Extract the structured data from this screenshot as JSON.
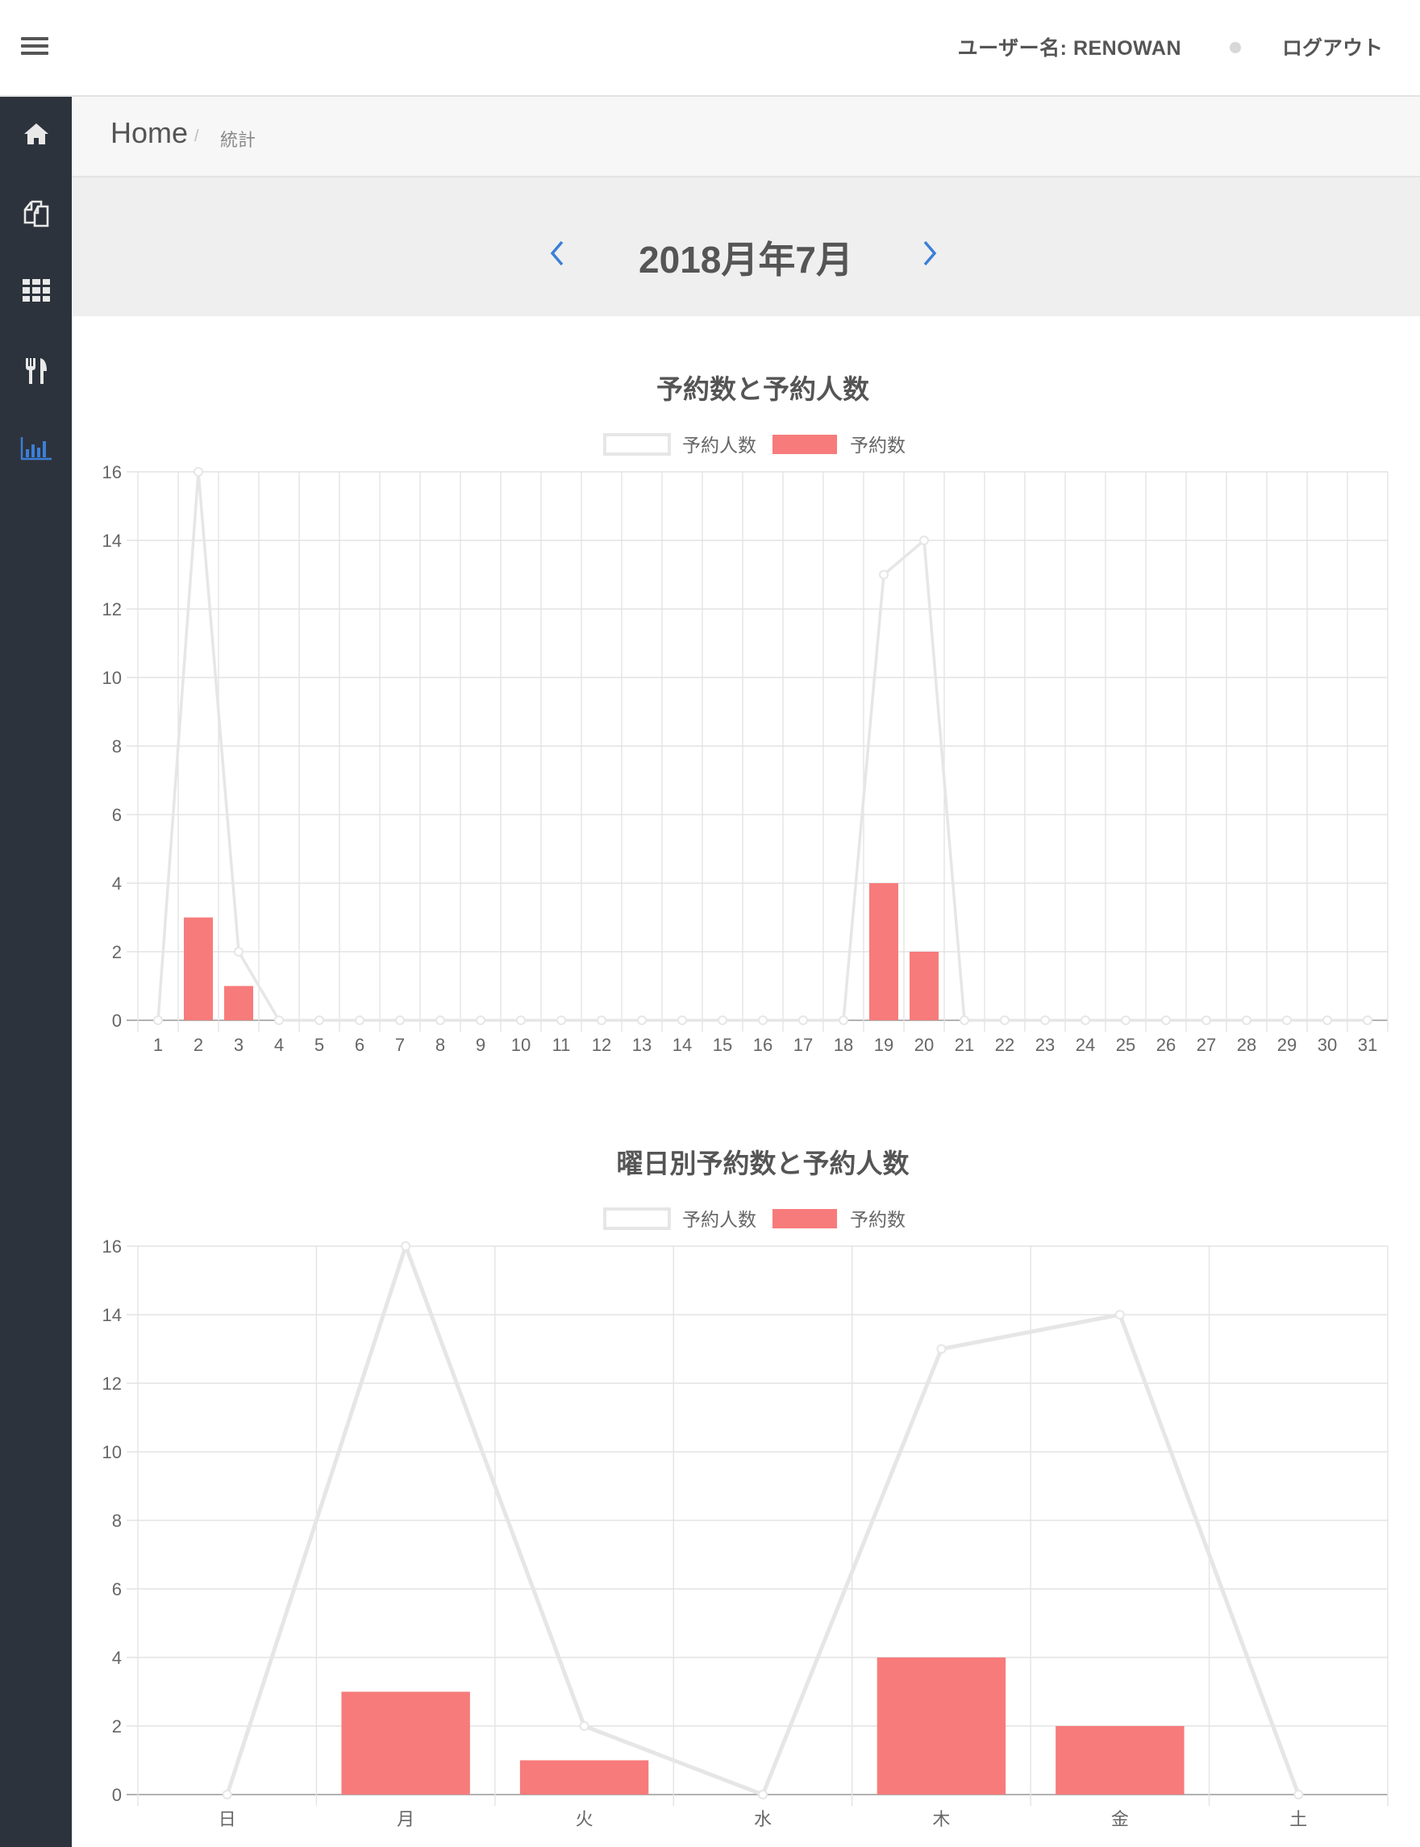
{
  "header": {
    "user_label": "ユーザー名: RENOWAN",
    "logout_label": "ログアウト"
  },
  "sidebar": {
    "items": [
      {
        "icon": "home-icon",
        "active": false
      },
      {
        "icon": "documents-icon",
        "active": false
      },
      {
        "icon": "grid-icon",
        "active": false
      },
      {
        "icon": "restaurant-icon",
        "active": false
      },
      {
        "icon": "bar-chart-icon",
        "active": true
      }
    ]
  },
  "breadcrumb": {
    "home": "Home",
    "separator": "/",
    "current": "統計"
  },
  "month_nav": {
    "title": "2018月年7月"
  },
  "colors": {
    "sidebar_bg": "#2d333c",
    "accent": "#3b7fd8",
    "bar": "#f77b7b",
    "line": "#e6e6e6"
  },
  "chart_data": [
    {
      "type": "bar",
      "title": "予約数と予約人数",
      "legend_position": "top",
      "grid": true,
      "categories": [
        "1",
        "2",
        "3",
        "4",
        "5",
        "6",
        "7",
        "8",
        "9",
        "10",
        "11",
        "12",
        "13",
        "14",
        "15",
        "16",
        "17",
        "18",
        "19",
        "20",
        "21",
        "22",
        "23",
        "24",
        "25",
        "26",
        "27",
        "28",
        "29",
        "30",
        "31"
      ],
      "ylim": [
        0,
        16
      ],
      "yticks": [
        0,
        2,
        4,
        6,
        8,
        10,
        12,
        14,
        16
      ],
      "series": [
        {
          "name": "予約人数",
          "kind": "line",
          "values": [
            0,
            16,
            2,
            0,
            0,
            0,
            0,
            0,
            0,
            0,
            0,
            0,
            0,
            0,
            0,
            0,
            0,
            0,
            13,
            14,
            0,
            0,
            0,
            0,
            0,
            0,
            0,
            0,
            0,
            0,
            0
          ]
        },
        {
          "name": "予約数",
          "kind": "bar",
          "values": [
            0,
            3,
            1,
            0,
            0,
            0,
            0,
            0,
            0,
            0,
            0,
            0,
            0,
            0,
            0,
            0,
            0,
            0,
            4,
            2,
            0,
            0,
            0,
            0,
            0,
            0,
            0,
            0,
            0,
            0,
            0
          ]
        }
      ]
    },
    {
      "type": "bar",
      "title": "曜日別予約数と予約人数",
      "legend_position": "top",
      "grid": true,
      "categories": [
        "日",
        "月",
        "火",
        "水",
        "木",
        "金",
        "土"
      ],
      "ylim": [
        0,
        16
      ],
      "yticks": [
        0,
        2,
        4,
        6,
        8,
        10,
        12,
        14,
        16
      ],
      "series": [
        {
          "name": "予約人数",
          "kind": "line",
          "values": [
            0,
            16,
            2,
            0,
            13,
            14,
            0
          ]
        },
        {
          "name": "予約数",
          "kind": "bar",
          "values": [
            0,
            3,
            1,
            0,
            4,
            2,
            0
          ]
        }
      ]
    }
  ]
}
